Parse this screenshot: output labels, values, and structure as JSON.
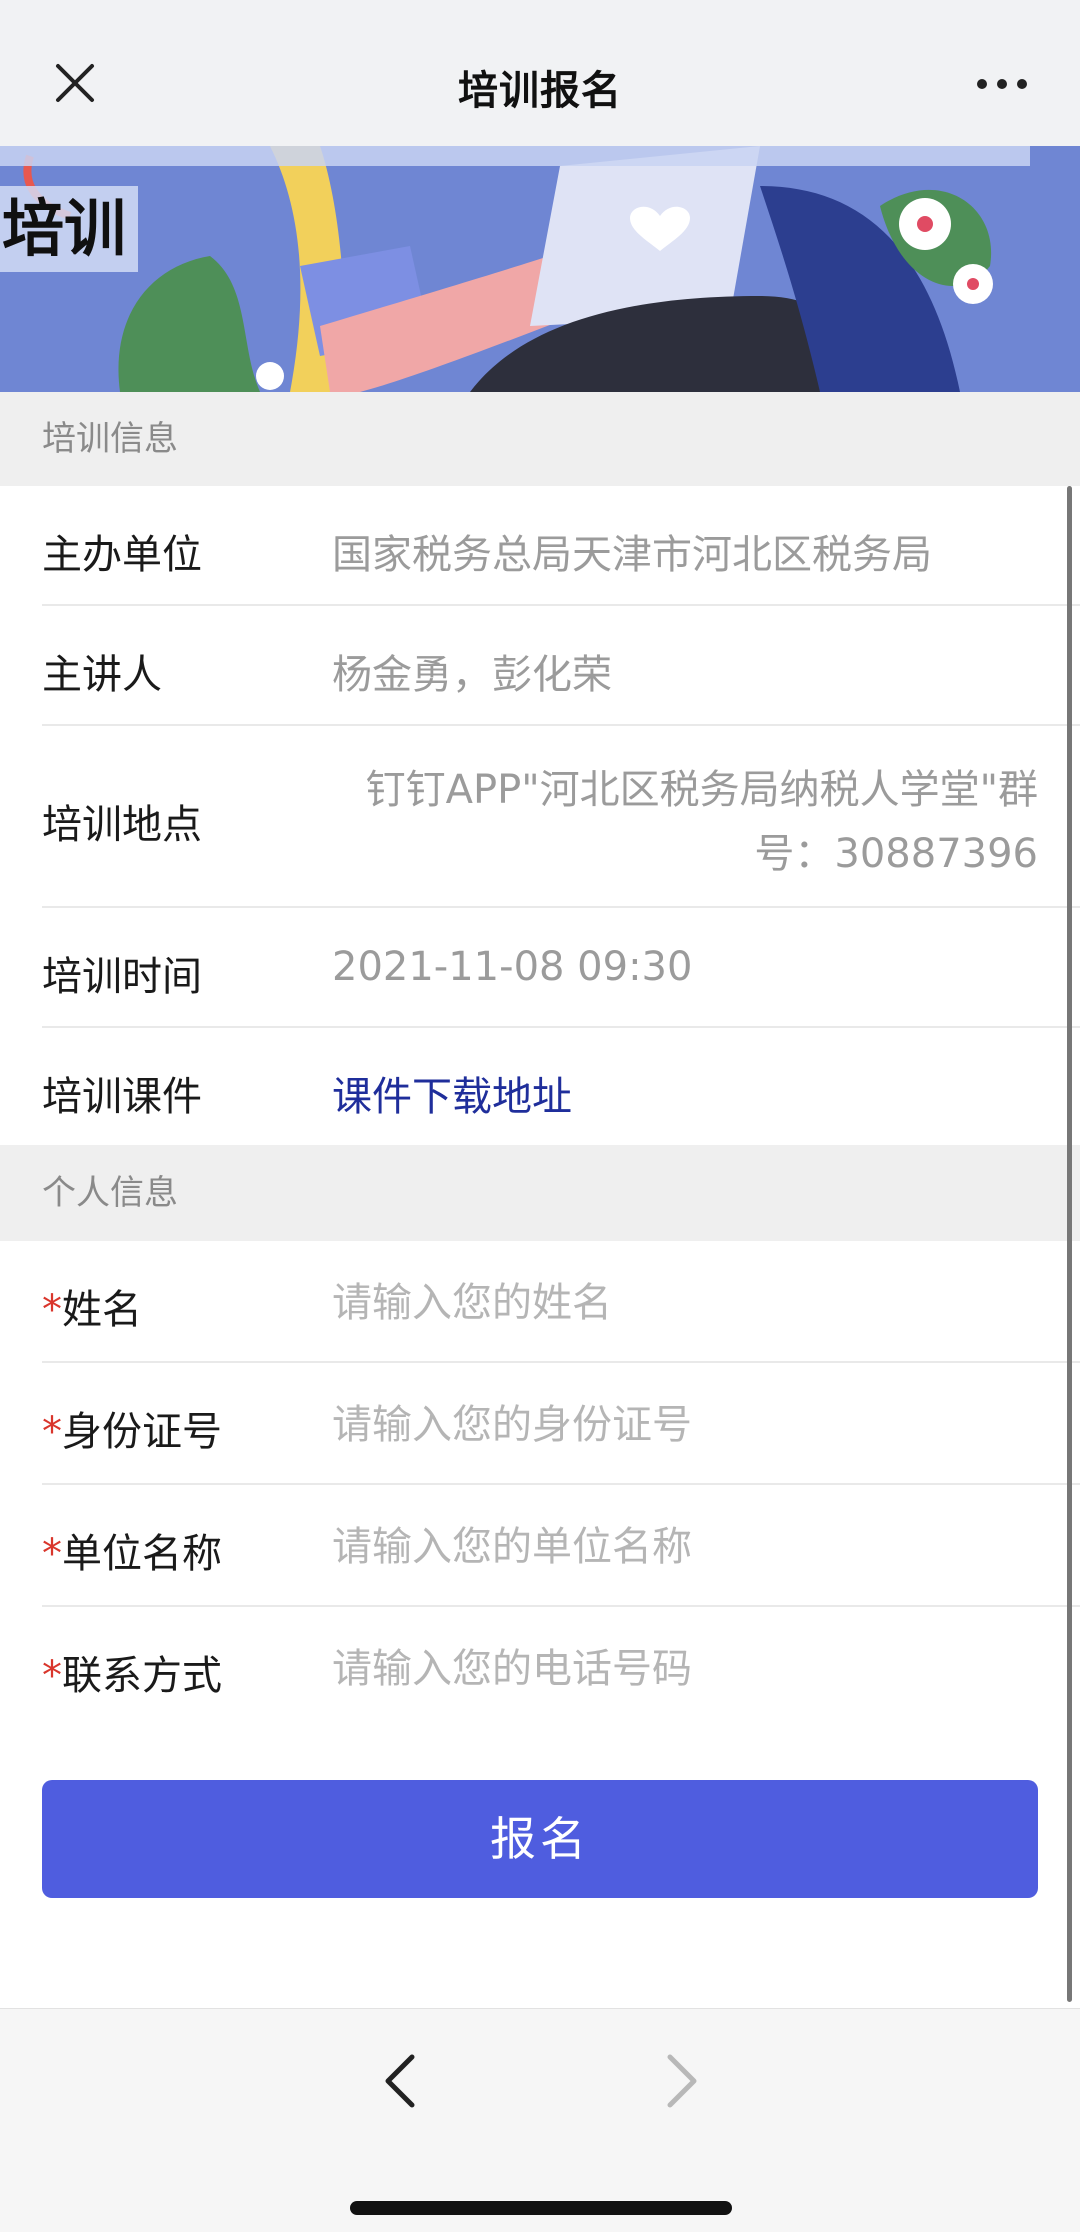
{
  "nav": {
    "title": "培训报名",
    "close_icon": "close-icon",
    "more_icon": "more-icon"
  },
  "banner": {
    "title_visible": "培训"
  },
  "training_info": {
    "section_title": "培训信息",
    "rows": [
      {
        "label": "主办单位",
        "value": "国家税务总局天津市河北区税务局"
      },
      {
        "label": "主讲人",
        "value": "杨金勇，彭化荣"
      },
      {
        "label": "培训地点",
        "value": "钉钉APP\"河北区税务局纳税人学堂\"群号：30887396"
      },
      {
        "label": "培训时间",
        "value": "2021-11-08 09:30"
      },
      {
        "label": "培训课件",
        "value": "课件下载地址"
      }
    ]
  },
  "personal_info": {
    "section_title": "个人信息",
    "required_mark": "*",
    "fields": [
      {
        "label": "姓名",
        "placeholder": "请输入您的姓名",
        "value": ""
      },
      {
        "label": "身份证号",
        "placeholder": "请输入您的身份证号",
        "value": ""
      },
      {
        "label": "单位名称",
        "placeholder": "请输入您的单位名称",
        "value": ""
      },
      {
        "label": "联系方式",
        "placeholder": "请输入您的电话号码",
        "value": ""
      }
    ]
  },
  "submit_label": "报名",
  "colors": {
    "primary_button": "#4f5ddf",
    "link": "#1f2e9b",
    "required": "#d9362c"
  }
}
